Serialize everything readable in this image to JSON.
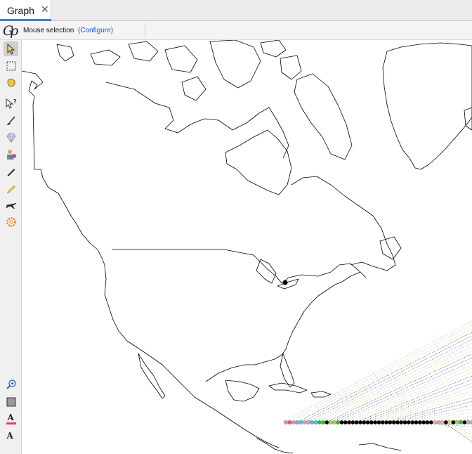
{
  "tabs": [
    {
      "label": "Graph",
      "close": "✕"
    }
  ],
  "toolbar": {
    "logo_icon": "gephi-logo-icon",
    "mode_label": "Mouse selection",
    "configure_label": "(Configure)"
  },
  "palette": {
    "tools": [
      {
        "name": "pointer-icon",
        "selected": true
      },
      {
        "name": "rectangle-selection-icon"
      },
      {
        "name": "lasso-selection-icon"
      },
      {
        "name": "query-icon"
      },
      {
        "name": "brush-icon"
      },
      {
        "name": "diamond-icon"
      },
      {
        "name": "painter-icon"
      },
      {
        "name": "pencil-icon"
      },
      {
        "name": "edge-pencil-icon"
      },
      {
        "name": "airplane-icon"
      },
      {
        "name": "gear-icon"
      }
    ],
    "bottom_tools": [
      {
        "name": "zoom-icon"
      },
      {
        "name": "background-color-icon"
      },
      {
        "name": "label-color-icon",
        "text": "A"
      },
      {
        "name": "label-size-icon",
        "text": "A"
      }
    ]
  },
  "map": {
    "node_colors": [
      "#e88fb8",
      "#d65c8a",
      "#7aa6e6",
      "#4fc3dc",
      "#b0b0b0",
      "#3fb23f",
      "#9ad04a",
      "#000000",
      "#f2a3c8",
      "#c8e87a"
    ],
    "colors": {
      "coastline": "#000000",
      "accent": "#3d7fc7",
      "link": "#1a4fd6"
    }
  }
}
